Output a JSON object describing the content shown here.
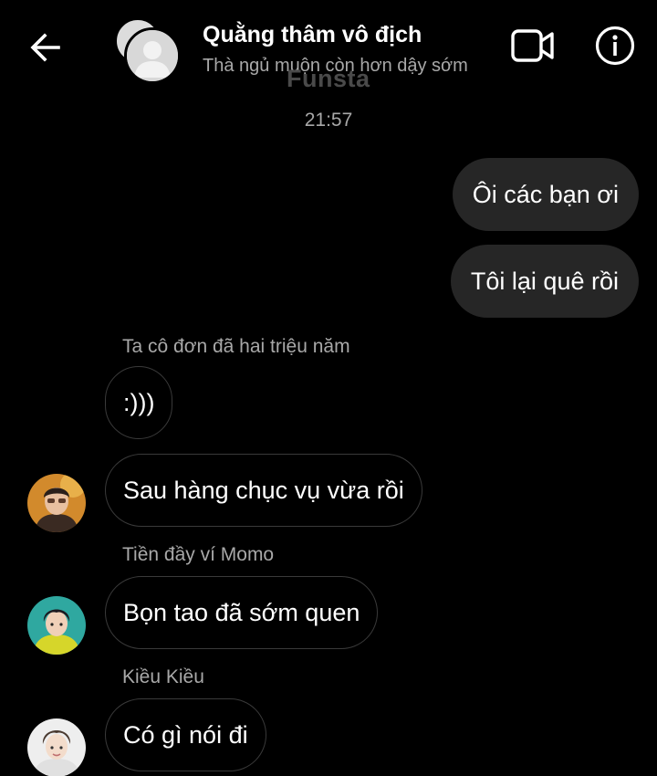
{
  "header": {
    "title": "Quằng thâm vô địch",
    "subtitle": "Thà ngủ muộn còn hơn dậy sớm",
    "watermark": "Funsta",
    "back_icon": "arrow-left-icon",
    "video_icon": "video-camera-icon",
    "info_icon": "info-icon"
  },
  "timestamp": "21:57",
  "messages": [
    {
      "direction": "out",
      "text": "Ôi các bạn ơi"
    },
    {
      "direction": "out",
      "text": "Tôi lại quê rồi"
    },
    {
      "direction": "in",
      "sender": "Ta cô đơn đã hai triệu năm",
      "text": ":)))"
    },
    {
      "direction": "in",
      "text": "Sau hàng chục vụ vừa rồi"
    },
    {
      "direction": "in",
      "sender": "Tiền đầy ví Momo",
      "text": "Bọn tao đã sớm quen"
    },
    {
      "direction": "in",
      "sender": "Kiều Kiều",
      "text": "Có gì nói đi"
    }
  ],
  "colors": {
    "background": "#000000",
    "outgoing_bubble": "#262626",
    "incoming_border": "#3a3a3a",
    "secondary_text": "#a8a8a8"
  }
}
